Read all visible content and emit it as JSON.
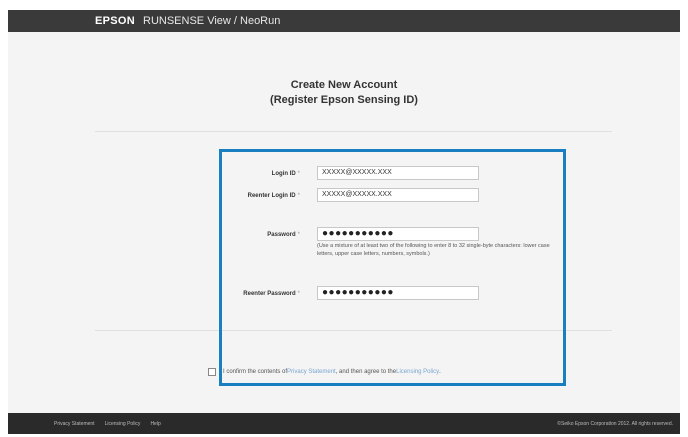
{
  "header": {
    "brand": "EPSON",
    "app_title": "RUNSENSE View / NeoRun"
  },
  "page": {
    "title_line1": "Create New Account",
    "title_line2": "(Register Epson Sensing ID)"
  },
  "form": {
    "required_mark": "*",
    "login_id": {
      "label": "Login ID",
      "value": "XXXXX@XXXXX.XXX"
    },
    "reenter_login_id": {
      "label": "Reenter Login ID",
      "value": "XXXXX@XXXXX.XXX"
    },
    "password": {
      "label": "Password",
      "value": "●●●●●●●●●●●",
      "hint": "(Use a mixture of at least two of the following to enter 8 to 32 single-byte characters: lower case letters, upper case letters, numbers, symbols.)"
    },
    "reenter_password": {
      "label": "Reenter Password",
      "value": "●●●●●●●●●●●"
    }
  },
  "consent": {
    "text_before": "I confirm the contents of ",
    "privacy_link": "Privacy Statement",
    "text_middle": ", and then agree to the ",
    "licensing_link": "Licensing Policy",
    "text_after": "."
  },
  "footer": {
    "links": [
      "Privacy Statement",
      "Licensing Policy",
      "Help"
    ],
    "copyright": "©Seiko Epson Corporation 2012. All rights reserved."
  },
  "colors": {
    "highlight": "#1a7fc1",
    "link": "#7aa6d1",
    "topbar": "#3a3a3a",
    "footer": "#2a2a2a"
  }
}
